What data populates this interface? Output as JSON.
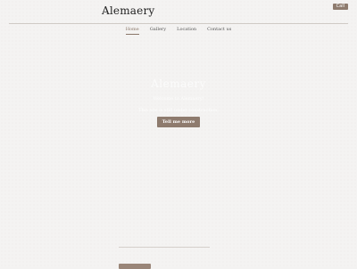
{
  "header": {
    "brand": "Alemaery",
    "call_label": "Call"
  },
  "nav": {
    "items": [
      {
        "label": "Home",
        "active": true
      },
      {
        "label": "Gallery",
        "active": false
      },
      {
        "label": "Location",
        "active": false
      },
      {
        "label": "Contact us",
        "active": false
      }
    ]
  },
  "hero": {
    "title": "Alemaery",
    "welcome": "Welcome to Alemaery!",
    "subtitle": "This site is still under construction.",
    "button_label": "Tell me more"
  },
  "colors": {
    "accent": "#8e7b6e",
    "background": "#f4f3f2"
  }
}
